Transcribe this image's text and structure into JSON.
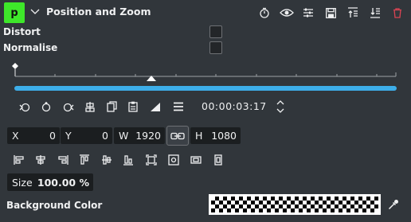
{
  "header": {
    "badge": "p",
    "title": "Position and Zoom",
    "icons": [
      "timer-icon",
      "eye-icon",
      "sliders-icon",
      "save-icon",
      "align-top-icon",
      "align-bottom-icon",
      "trash-icon"
    ],
    "trash_color": "#da4453"
  },
  "options": {
    "distort_label": "Distort",
    "normalise_label": "Normalise"
  },
  "timeline": {
    "accent": "#3daee9",
    "timecode": "00:00:03:17"
  },
  "geometry": {
    "x_label": "X",
    "x_value": "0",
    "y_label": "Y",
    "y_value": "0",
    "w_label": "W",
    "w_value": "1920",
    "h_label": "H",
    "h_value": "1080"
  },
  "size": {
    "label": "Size",
    "value": "100.00 %"
  },
  "background": {
    "label": "Background Color"
  },
  "colors": {
    "panel_bg": "#31363b",
    "field_bg": "#1b1e20",
    "badge_green": "#3ee72a"
  }
}
